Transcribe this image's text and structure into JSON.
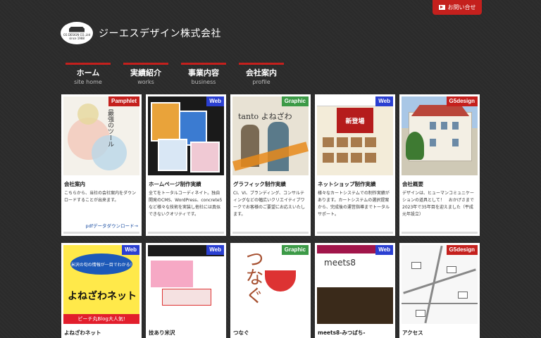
{
  "header": {
    "contact_label": "お問い合せ",
    "logo_small": "GS DESIGN CO.,Ltd",
    "logo_since": "since 1988",
    "company_name": "ジーエスデザイン株式会社"
  },
  "nav": [
    {
      "jp": "ホーム",
      "en": "site home"
    },
    {
      "jp": "実績紹介",
      "en": "works"
    },
    {
      "jp": "事業内容",
      "en": "business"
    },
    {
      "jp": "会社案内",
      "en": "profile"
    }
  ],
  "badge_colors": {
    "Pamphlet": "#c4201d",
    "Web": "#2a3fd1",
    "Graphic": "#3c9a47",
    "G5design": "#c4201d"
  },
  "thumb_text": {
    "t1_vertical": "最強のツール",
    "t3_tanto": "tanto よねざわ",
    "t4_banner": "新登場",
    "t6_banner": "米沢の旬の情報が一目でわかる!",
    "t6_name": "よねざわネット",
    "t6_strip": "ピーチ丸Blog大人気!",
    "t8_big": "つなぐ",
    "t9_title": "meets8"
  },
  "cards": [
    {
      "badge": "Pamphlet",
      "title": "会社案内",
      "desc": "こちらから、当社の会社案内をダウンロードすることが出来ます。",
      "link": "pdfデータダウンロード→"
    },
    {
      "badge": "Web",
      "title": "ホームページ制作実績",
      "desc": "全てをトータルコーディネイト。独自開発のCMS、WordPress、concrete5など様々な技術を実装し他社には真似できないクオリティです。",
      "link": ""
    },
    {
      "badge": "Graphic",
      "title": "グラフィック制作実績",
      "desc": "CI、VI、ブランディング、コンサルティングなどの幅広いクリエイティブワークでお客様のご要望にお応えいたします。",
      "link": ""
    },
    {
      "badge": "Web",
      "title": "ネットショップ制作実績",
      "desc": "様々なカートシステムでの制作実績があります。カートシステムの選択提案から、完成後の運営指導までトータルサポート。",
      "link": ""
    },
    {
      "badge": "G5design",
      "title": "会社概要",
      "desc": "デザインは、ヒューマンコミュニケーションの道具として！　おかげさまで2023年で35年目を迎えました（平成元年設立）",
      "link": ""
    },
    {
      "badge": "Web",
      "title": "よねざわネット",
      "desc": "",
      "link": ""
    },
    {
      "badge": "Web",
      "title": "技あり米沢",
      "desc": "",
      "link": ""
    },
    {
      "badge": "Graphic",
      "title": "つなぐ",
      "desc": "",
      "link": ""
    },
    {
      "badge": "Web",
      "title": "meets8-みつばち-",
      "desc": "",
      "link": ""
    },
    {
      "badge": "G5design",
      "title": "アクセス",
      "desc": "",
      "link": ""
    }
  ]
}
